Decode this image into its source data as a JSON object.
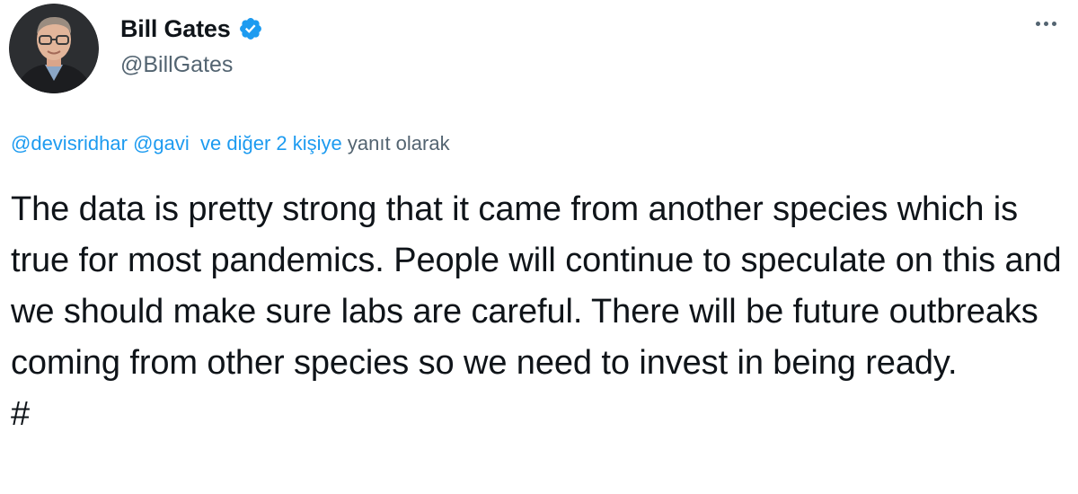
{
  "author": {
    "name": "Bill Gates",
    "handle": "@BillGates"
  },
  "icons": {
    "verified": "verified-badge-icon",
    "more": "more-options-icon"
  },
  "reply": {
    "mention_1": "@devisridhar",
    "mention_2": "@gavi",
    "others": "ve diğer 2 kişiye",
    "suffix": "yanıt olarak"
  },
  "tweet": {
    "text": "The data is pretty strong that it came from another species which is true for most pandemics. People will continue to speculate on this and we should make sure labs are careful. There will be future outbreaks coming from other species so we need to invest in being ready.",
    "hashtag": "#"
  },
  "colors": {
    "accent": "#1d9bf0",
    "text": "#0f1419",
    "secondary": "#536471"
  }
}
